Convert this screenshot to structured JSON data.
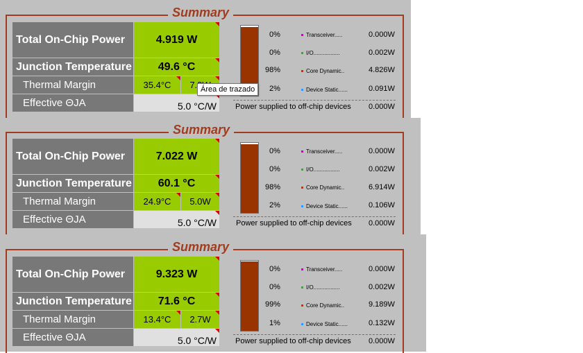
{
  "labels": {
    "total": "Total On-Chip Power",
    "junction": "Junction Temperature",
    "thermal": "Thermal Margin",
    "theta": "Effective ΘJA",
    "offchip": "Power supplied to off-chip devices"
  },
  "legend": {
    "transceiver": "Transceiver.....",
    "io": "I/O.................",
    "core": "Core Dynamic..",
    "static": "Device Static......"
  },
  "legend_colors": {
    "transceiver": "#cc00cc",
    "io": "#33aa33",
    "core": "#cc3300",
    "static": "#3399ff"
  },
  "accent": "#a23c1e",
  "bar_color": "#993300",
  "panels": [
    {
      "title": "Summary",
      "total_power": "4.919 W",
      "junction_temp": "49.6 °C",
      "thermal_margin_c": "35.4°C",
      "thermal_margin_w": "7.3W",
      "theta_ja": "5.0 °C/W",
      "bar_fill": 0.98,
      "pct": {
        "transceiver": "0%",
        "io": "0%",
        "core": "98%",
        "static": "2%"
      },
      "watts": {
        "transceiver": "0.000W",
        "io": "0.002W",
        "core": "4.826W",
        "static": "0.091W"
      },
      "offchip_w": "0.000W"
    },
    {
      "title": "Summary",
      "total_power": "7.022 W",
      "junction_temp": "60.1 °C",
      "thermal_margin_c": "24.9°C",
      "thermal_margin_w": "5.0W",
      "theta_ja": "5.0 °C/W",
      "bar_fill": 0.98,
      "pct": {
        "transceiver": "0%",
        "io": "0%",
        "core": "98%",
        "static": "2%"
      },
      "watts": {
        "transceiver": "0.000W",
        "io": "0.002W",
        "core": "6.914W",
        "static": "0.106W"
      },
      "offchip_w": "0.000W"
    },
    {
      "title": "Summary",
      "total_power": "9.323 W",
      "junction_temp": "71.6 °C",
      "thermal_margin_c": "13.4°C",
      "thermal_margin_w": "2.7W",
      "theta_ja": "5.0 °C/W",
      "bar_fill": 0.99,
      "pct": {
        "transceiver": "0%",
        "io": "0%",
        "core": "99%",
        "static": "1%"
      },
      "watts": {
        "transceiver": "0.000W",
        "io": "0.002W",
        "core": "9.189W",
        "static": "0.132W"
      },
      "offchip_w": "0.000W"
    }
  ],
  "tooltip": "Área de trazado"
}
